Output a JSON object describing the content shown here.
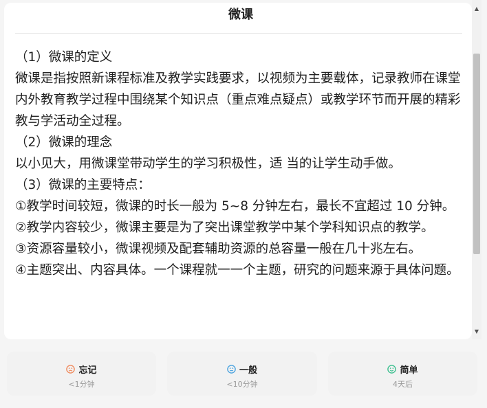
{
  "header": {
    "title": "微课"
  },
  "content": {
    "paragraphs": [
      "（1）微课的定义",
      "微课是指按照新课程标准及教学实践要求，以视频为主要载体，记录教师在课堂内外教育教学过程中围绕某个知识点（重点难点疑点）或教学环节而开展的精彩教与学活动全过程。",
      "（2）微课的理念",
      "以小见大，用微课堂带动学生的学习积极性，适 当的让学生动手做。",
      "（3）微课的主要特点：",
      "①教学时间较短，微课的时长一般为 5~8 分钟左右，最长不宜超过 10 分钟。",
      "②教学内容较少，微课主要是为了突出课堂教学中某个学科知识点的教学。",
      "③资源容量较小，微课视频及配套辅助资源的总容量一般在几十兆左右。",
      "④主题突出、内容具体。一个课程就一一个主题，研究的问题来源于具体问题。"
    ]
  },
  "buttons": {
    "forget": {
      "label": "忘记",
      "sub": "<1分钟",
      "color": "#f08a5d",
      "icon": "sad-face-icon"
    },
    "normal": {
      "label": "一般",
      "sub": "<10分钟",
      "color": "#4aa3df",
      "icon": "neutral-face-icon"
    },
    "easy": {
      "label": "简单",
      "sub": "4天后",
      "color": "#3cbf8f",
      "icon": "smile-face-icon"
    }
  }
}
